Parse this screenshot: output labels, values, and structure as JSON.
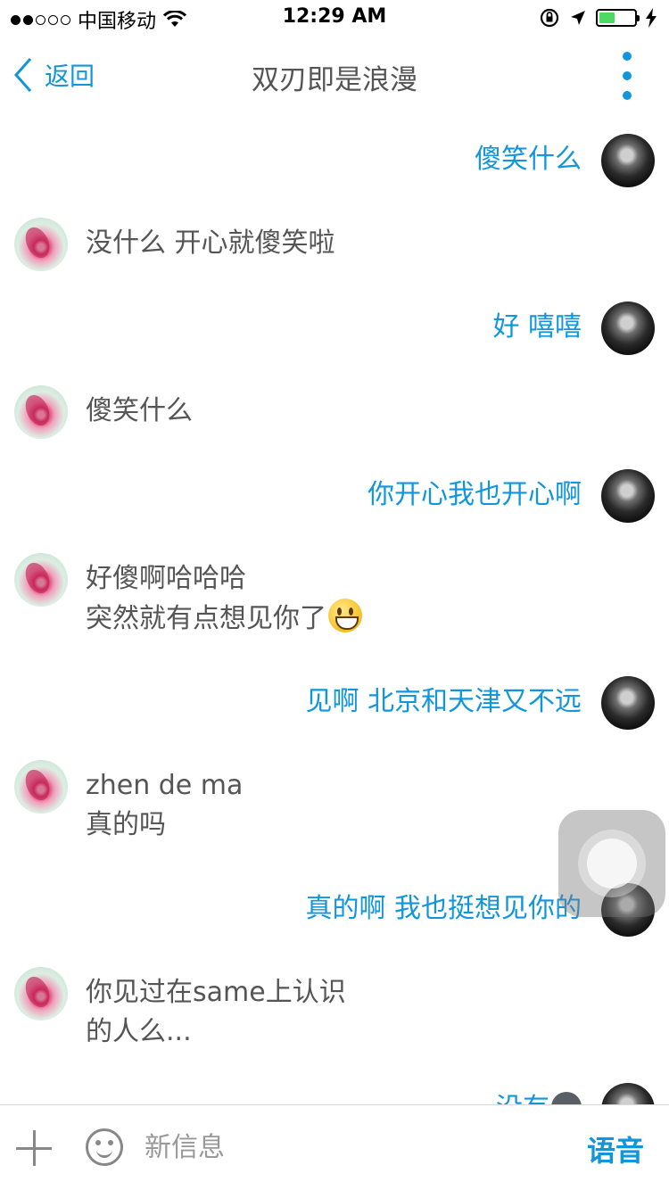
{
  "status_bar": {
    "carrier": "中国移动",
    "time": "12:29 AM",
    "signal_dots_filled": 2,
    "signal_dots_total": 5,
    "battery_level": 0.45
  },
  "nav": {
    "back_label": "返回",
    "title": "双刃即是浪漫"
  },
  "messages": [
    {
      "from": "me",
      "text": "傻笑什么"
    },
    {
      "from": "other",
      "text": "没什么 开心就傻笑啦"
    },
    {
      "from": "me",
      "text": "好 嘻嘻"
    },
    {
      "from": "other",
      "text": "傻笑什么"
    },
    {
      "from": "me",
      "text": "你开心我也开心啊"
    },
    {
      "from": "other",
      "text": "好傻啊哈哈哈\n突然就有点想见你了",
      "emoji": "grinning-face-emoji"
    },
    {
      "from": "me",
      "text": "见啊 北京和天津又不远"
    },
    {
      "from": "other",
      "text": "zhen de ma\n真的吗"
    },
    {
      "from": "me",
      "text": "真的啊 我也挺想见你的"
    },
    {
      "from": "other",
      "text": "你见过在same上认识\n的人么..."
    },
    {
      "from": "me",
      "text": "没有",
      "emoji": "dark-face-emoji"
    }
  ],
  "input_bar": {
    "placeholder": "新信息",
    "voice_label": "语音"
  },
  "colors": {
    "accent": "#1296db",
    "text": "#555555"
  }
}
